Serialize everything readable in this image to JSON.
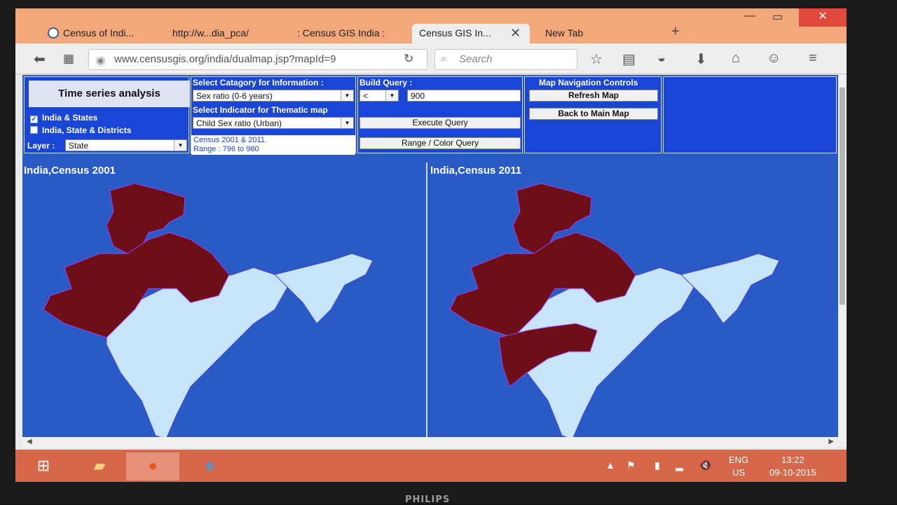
{
  "browser": {
    "tabs": [
      {
        "label": "Census of Indi..."
      },
      {
        "label": "http://w...dia_pca/"
      },
      {
        "label": ": Census GIS India :"
      },
      {
        "label": "Census GIS In..."
      },
      {
        "label": "New Tab"
      }
    ],
    "url": "www.censusgis.org/india/dualmap.jsp?mapId=9",
    "search_placeholder": "Search"
  },
  "controls": {
    "time_series_title": "Time series analysis",
    "layer_options": [
      {
        "label": "India & States",
        "checked": true
      },
      {
        "label": "India, State & Districts",
        "checked": false
      }
    ],
    "layer_label": "Layer :",
    "layer_value": "State",
    "category_label": "Select Catagory for Information :",
    "category_value": "Sex ratio (0-6 years)",
    "indicator_label": "Select Indicator for Thematic map",
    "indicator_value": "Child Sex ratio (Urban)",
    "census_info": "Census 2001 & 2011",
    "range_info": "Range : 796 to 980",
    "build_query_label": "Build Query :",
    "operator_value": "<",
    "query_value": "900",
    "execute_label": "Execute Query",
    "range_color_label": "Range / Color Query",
    "nav_title": "Map Navigation Controls",
    "refresh_label": "Refresh Map",
    "back_label": "Back to Main Map"
  },
  "maps": {
    "left_title": "India,Census 2001",
    "right_title": "India,Census 2011",
    "highlight_color": "#6e0e16",
    "base_color": "#c8e4f8",
    "border_color": "#4444dd"
  },
  "taskbar": {
    "lang": "ENG",
    "region": "US",
    "time": "13:22",
    "date": "09-10-2015"
  },
  "monitor_brand": "PHILIPS"
}
